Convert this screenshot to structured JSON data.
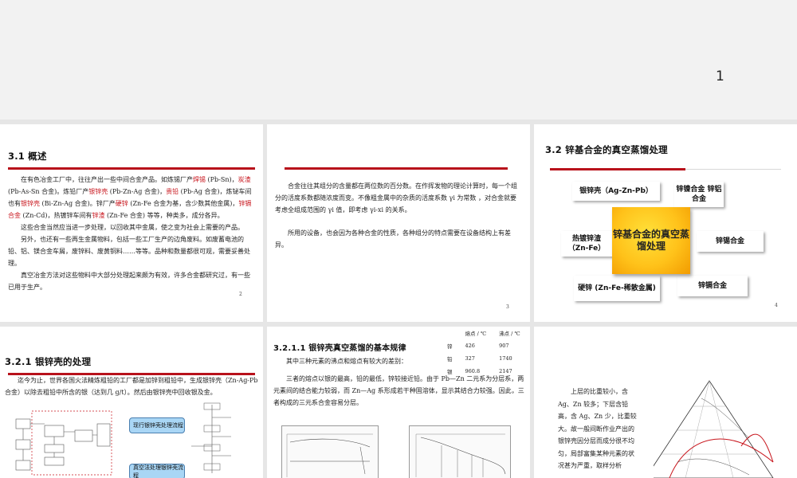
{
  "page_number": "1",
  "slide2": {
    "title": "3.1  概述",
    "p1": [
      "在有色冶金工厂中，往往产出一些中间合金产品。如炼锡厂产",
      "焊锡",
      " (Pb-Sn)，",
      "炭渣",
      " (Pb-As-Sn 合金)。炼铅厂产",
      "银锌壳",
      " (Pb-Zn-Ag 合金)，",
      "贵铅",
      " (Pb-Ag 合金)，炼铋车间也有",
      "银锌壳",
      " (Bi-Zn-Ag 合金)。锌厂产",
      "硬锌",
      " (Zn-Fe 合金为基，含少数其他金属)，",
      "锌镉合金",
      " (Zn-Cd)，热镀锌车间有",
      "锌渣",
      " (Zn-Fe 合金) 等等，种类多，成分各异。"
    ],
    "p2": "这些合金当然应当进一步处理，以回收其中金属，使之变为社会上需要的产品。",
    "p3": "另外，也还有一些再生金属物料，包括一些工厂生产的边角废料。如废蓄电池的铅、铝、镁合金车屑，废锌料、废黄铜料……等等。品种和数量都很可观，需要妥善处理。",
    "p4": "真空冶金方法对这些物料中大部分处理起来颇为有效，许多合金都研究过，有一些已用于生产。",
    "num": "2"
  },
  "slide3": {
    "p1": "合金往往其组分的含量都在两位数的百分数。在作挥发物的理论计算时，每一个组分的活度系数都随浓度而变。不像粗金属中的杂质的活度系数 γi 为常数 ，对合金就要考虑全组成范围的 γi 值，即考虑 γi-xi 的关系。",
    "p2": "所用的设备，也会因为各种合金的性质，各种组分的特点需要在设备结构上有差异。",
    "num": "3"
  },
  "slide4": {
    "title": "3.2  锌基合金的真空蒸馏处理",
    "center": "锌基合金的真空蒸馏处理",
    "boxes": {
      "b1": "银锌壳（Ag-Zn-Pb）",
      "b2": "锌镍合金 锌铝合金",
      "b3": "热镀锌渣 （Zn-Fe）",
      "b4": "锌锡合金",
      "b5": "硬锌 (Zn-Fe-稀散金属)",
      "b6": "锌镉合金"
    },
    "num": "4"
  },
  "slide5": {
    "title": "3.2.1  银锌壳的处理",
    "p1": "迄今为止，世界各国火法精炼粗铅的工厂都是加锌到粗铅中，生成银锌壳（Zn-Ag-Pb 合金）以除去粗铅中所含的银（达到几 g/t）。然后由银锌壳中回收银及金。",
    "btn1": "现行银锌壳处理流程",
    "btn2": "真空法处理银锌壳流程"
  },
  "slide6": {
    "title": "3.2.1.1  银锌壳真空蒸馏的基本规律",
    "intro": "其中三种元素的沸点和熔点有较大的差别：",
    "table": {
      "headers": [
        "",
        "熔点 / ℃",
        "沸点 / ℃"
      ],
      "rows": [
        [
          "锌",
          "426",
          "907"
        ],
        [
          "铅",
          "327",
          "1740"
        ],
        [
          "银",
          "960.8",
          "2147"
        ]
      ]
    },
    "p1": "三者的熔点以银的最高，铅的最低，锌较接近铅。由于 Pb—Zn 二元系为分层系，两元素间的结合能力较弱，而 Zn—Ag 系形成若干种固溶体，显示其结合力较强。因此，三者构成的三元系合金容易分层。"
  },
  "slide7": {
    "text": "上层的比重较小，含 Ag、Zn 较多；下层含铅高，含 Ag、Zn 少，比重较大。故一般间断作业产出的银锌壳因分层而成分很不均匀，局部富集某种元素的状况甚为严重，取样分析"
  }
}
